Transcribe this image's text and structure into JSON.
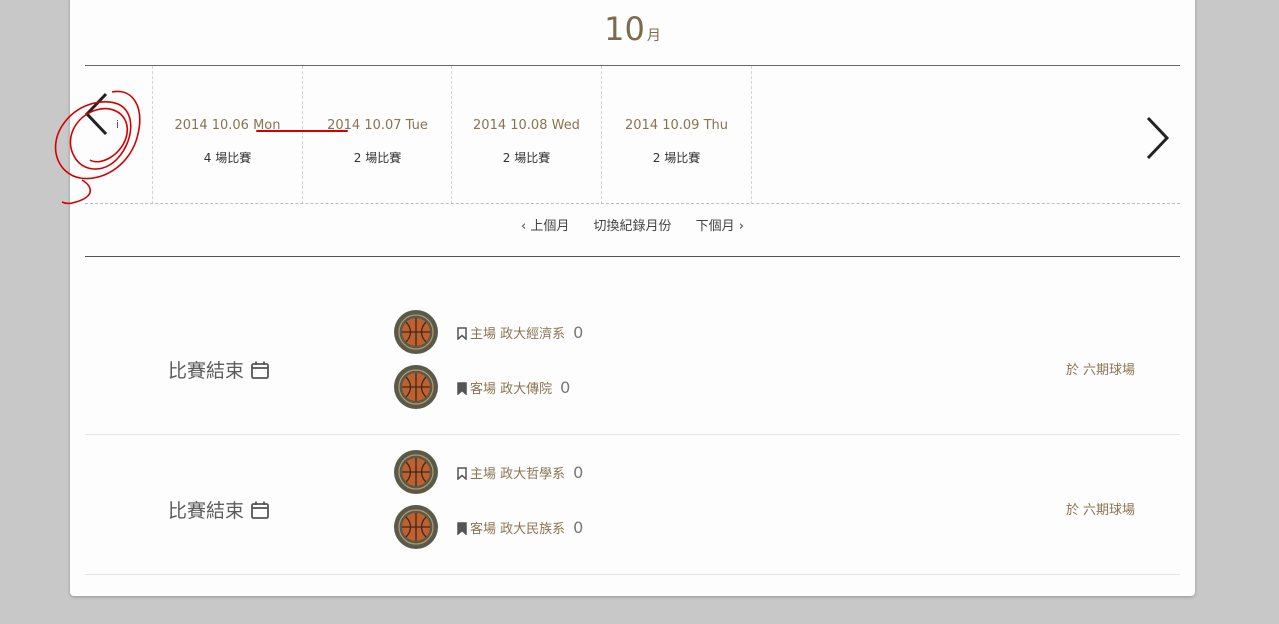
{
  "header": {
    "month_number": "10",
    "month_unit": "月"
  },
  "dates": [
    {
      "date": "2014 10.06 Mon",
      "count": "4 場比賽",
      "active": true
    },
    {
      "date": "2014 10.07 Tue",
      "count": "2 場比賽"
    },
    {
      "date": "2014 10.08 Wed",
      "count": "2 場比賽"
    },
    {
      "date": "2014 10.09 Thu",
      "count": "2 場比賽"
    }
  ],
  "prev_marker": "i",
  "month_nav": {
    "prev": "上個月",
    "switch": "切換紀錄月份",
    "next": "下個月"
  },
  "games": [
    {
      "status": "比賽結束",
      "home": {
        "tag": "主場",
        "team": "政大經濟系",
        "score": "0"
      },
      "away": {
        "tag": "客場",
        "team": "政大傳院",
        "score": "0"
      },
      "venue_prefix": "於",
      "venue": "六期球場"
    },
    {
      "status": "比賽結束",
      "home": {
        "tag": "主場",
        "team": "政大哲學系",
        "score": "0"
      },
      "away": {
        "tag": "客場",
        "team": "政大民族系",
        "score": "0"
      },
      "venue_prefix": "於",
      "venue": "六期球場"
    }
  ],
  "icons": {
    "prev_day": "chevron-left-icon",
    "next_day": "chevron-right-icon",
    "calendar": "calendar-icon",
    "home_tag": "bookmark-outline-icon",
    "away_tag": "bookmark-filled-icon",
    "team_logo": "basketball-icon"
  },
  "colors": {
    "accent": "#8a7450",
    "annotation": "#d40000",
    "background": "#c8c8c8"
  }
}
